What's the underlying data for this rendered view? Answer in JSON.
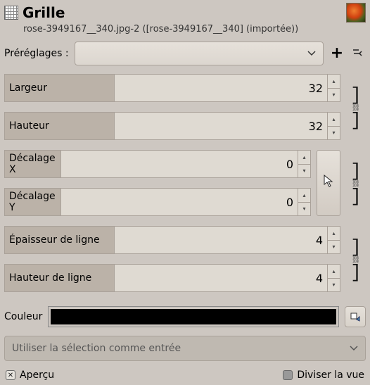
{
  "header": {
    "title": "Grille",
    "subtitle": "rose-3949167__340.jpg-2 ([rose-3949167__340] (importée))"
  },
  "presets": {
    "label": "Préréglages :",
    "selected": ""
  },
  "fields": {
    "width": {
      "label": "Largeur",
      "value": "32"
    },
    "height": {
      "label": "Hauteur",
      "value": "32"
    },
    "offx": {
      "label": "Décalage X",
      "value": "0"
    },
    "offy": {
      "label": "Décalage Y",
      "value": "0"
    },
    "lwidth": {
      "label": "Épaisseur de ligne",
      "value": "4"
    },
    "lheight": {
      "label": "Hauteur de ligne",
      "value": "4"
    }
  },
  "color": {
    "label": "Couleur",
    "value": "#000000"
  },
  "input_source": {
    "label": "Utiliser la sélection comme entrée"
  },
  "footer": {
    "preview": "Aperçu",
    "split": "Diviser la vue"
  }
}
